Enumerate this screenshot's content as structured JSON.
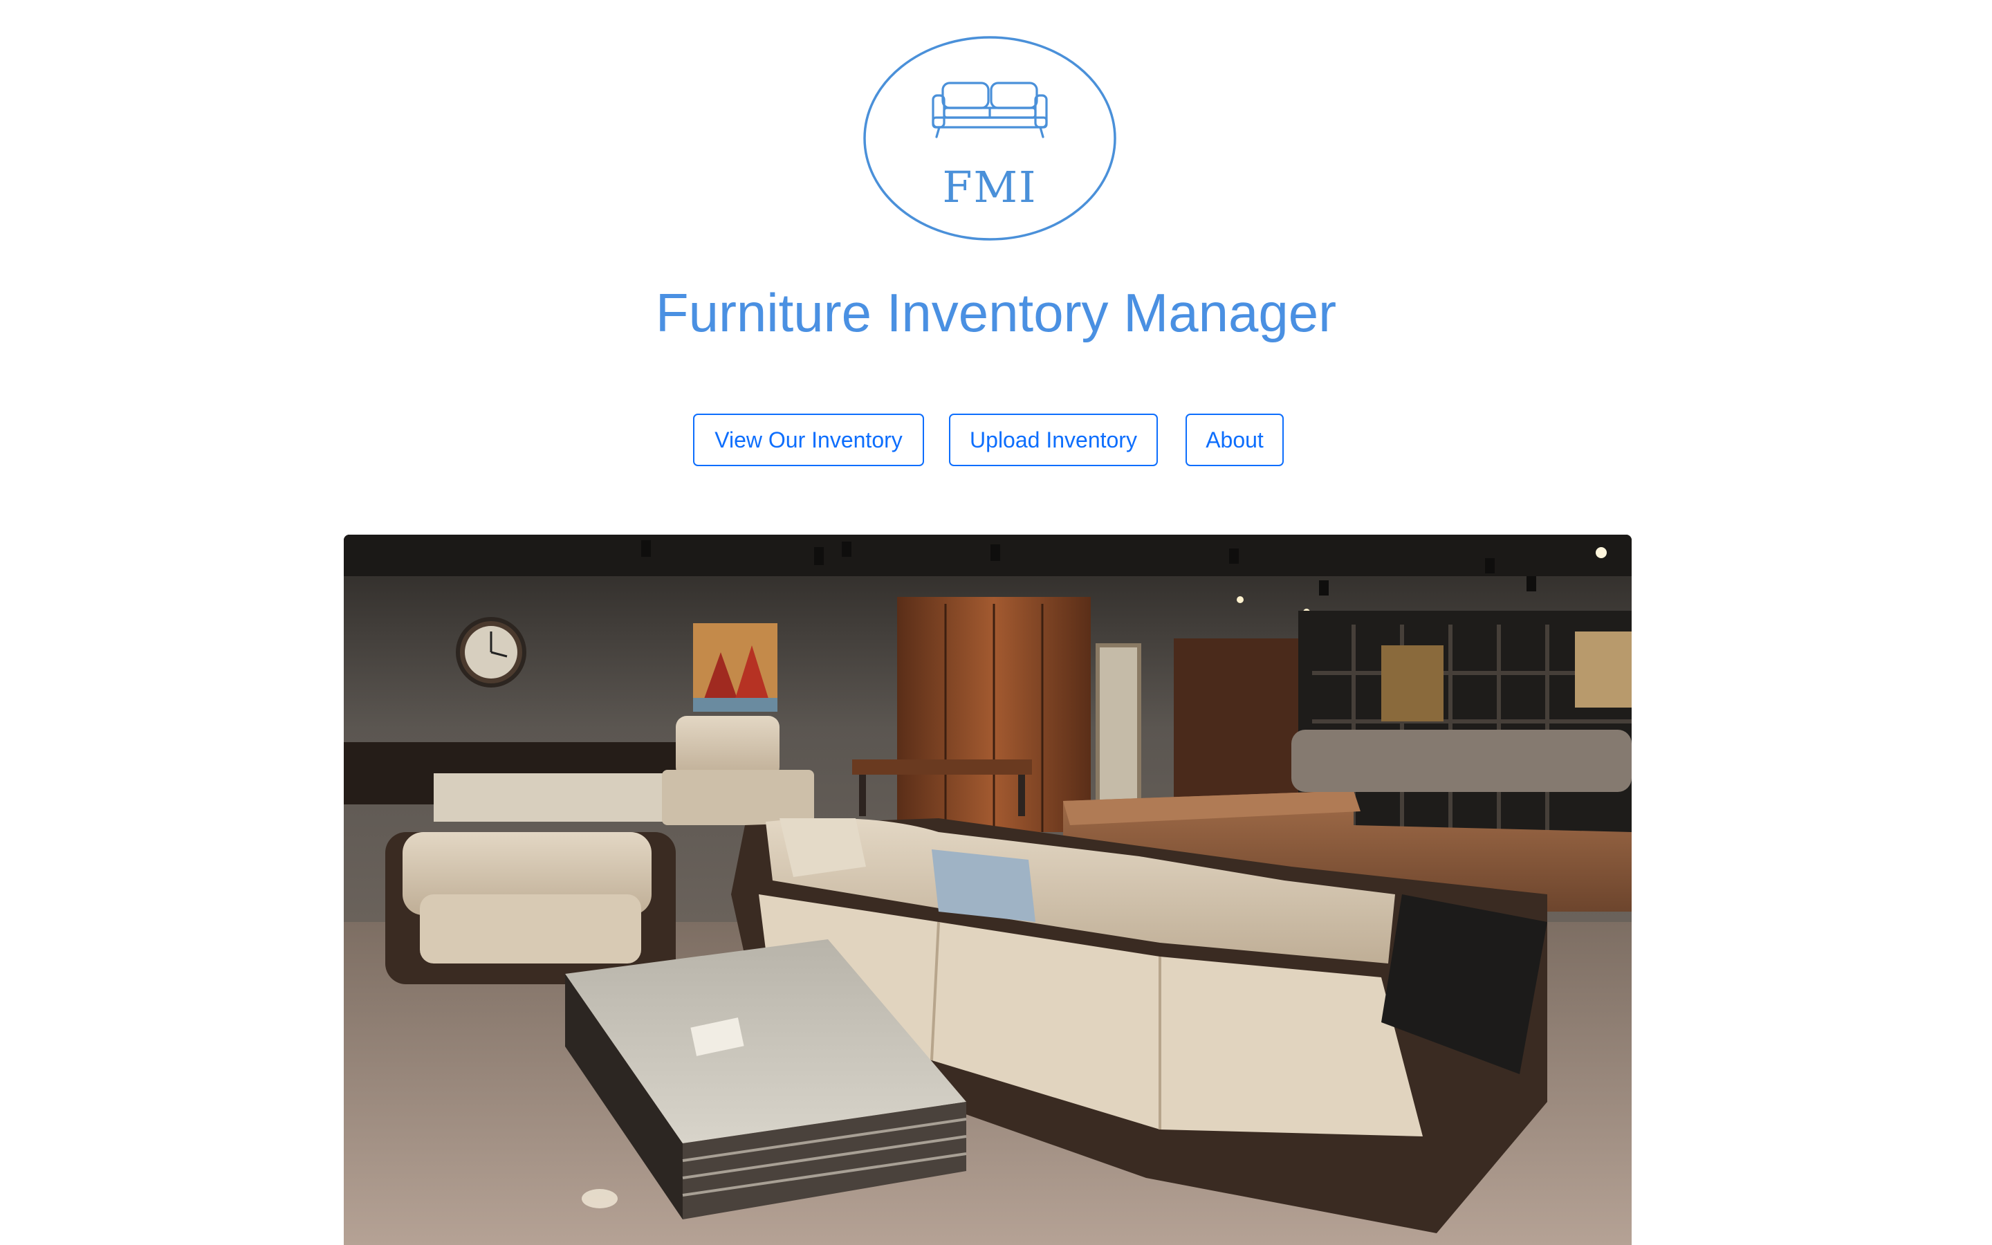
{
  "logo": {
    "icon": "sofa-icon",
    "text": "FMI",
    "color": "#4a90d9"
  },
  "header": {
    "title": "Furniture Inventory Manager",
    "title_color": "#4a90e2"
  },
  "nav": {
    "buttons": [
      {
        "label": "View Our Inventory"
      },
      {
        "label": "Upload Inventory"
      },
      {
        "label": "About"
      }
    ],
    "accent": "#0d6efd"
  },
  "hero": {
    "subject": "furniture-showroom-photo"
  }
}
